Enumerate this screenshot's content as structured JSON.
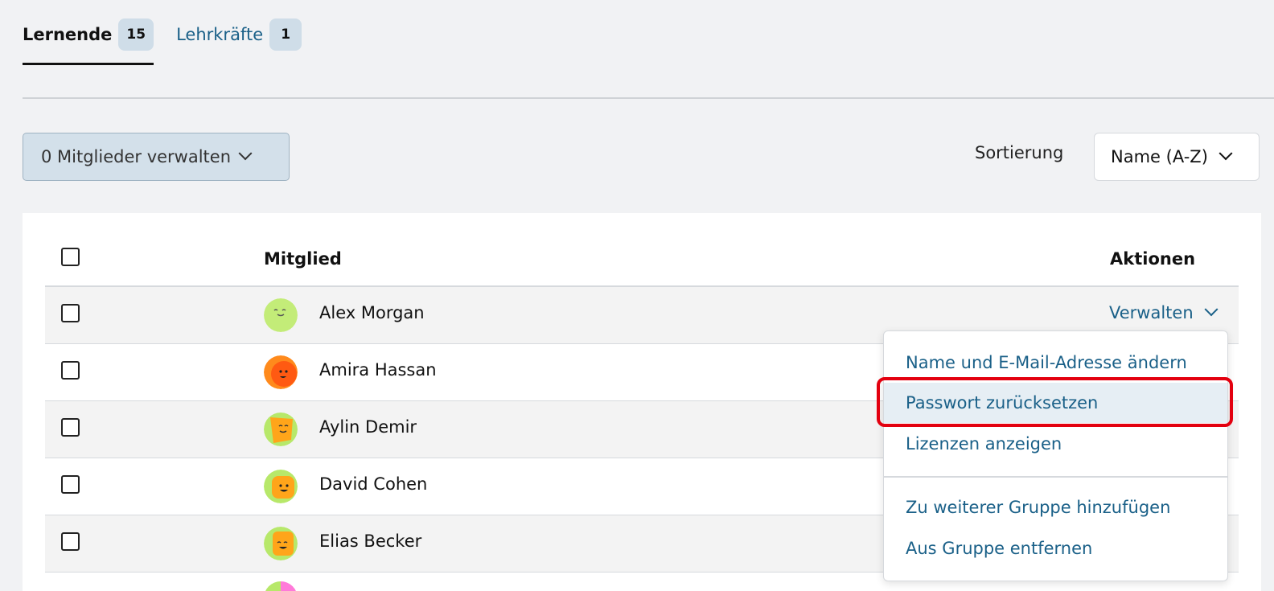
{
  "tabs": [
    {
      "label": "Lernende",
      "count": "15",
      "active": true
    },
    {
      "label": "Lehrkräfte",
      "count": "1",
      "active": false
    }
  ],
  "toolbar": {
    "manage_label": "0 Mitglieder verwalten",
    "sort_label": "Sortierung",
    "sort_value": "Name (A-Z)"
  },
  "table": {
    "col_member": "Mitglied",
    "col_actions": "Aktionen",
    "rows": [
      {
        "name": "Alex Morgan"
      },
      {
        "name": "Amira Hassan"
      },
      {
        "name": "Aylin Demir"
      },
      {
        "name": "David Cohen"
      },
      {
        "name": "Elias Becker"
      }
    ],
    "row_action_label": "Verwalten"
  },
  "dropdown": {
    "items": [
      "Name und E-Mail-Adresse ändern",
      "Passwort zurücksetzen",
      "Lizenzen anzeigen",
      "Zu weiterer Gruppe hinzufügen",
      "Aus Gruppe entfernen"
    ]
  },
  "colors": {
    "link": "#1a6088",
    "highlight_border": "#e3000f",
    "badge_bg": "#cfdde8"
  }
}
